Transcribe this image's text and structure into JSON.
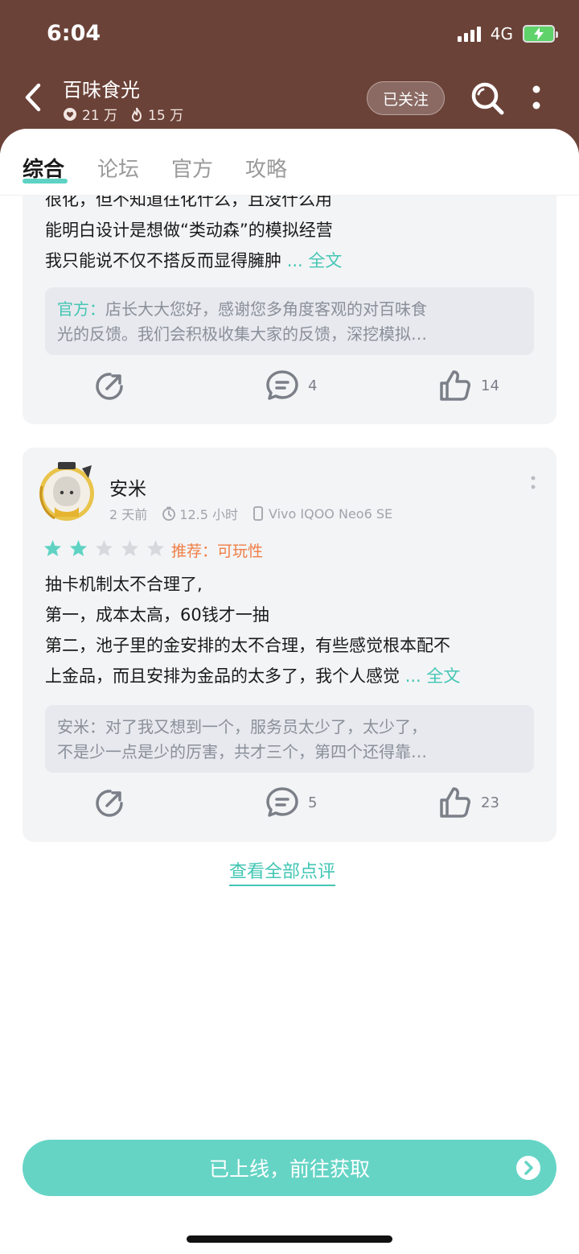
{
  "status_bar": {
    "time": "6:04",
    "network": "4G"
  },
  "header": {
    "title": "百味食光",
    "likes": "21 万",
    "hot": "15 万",
    "follow_label": "已关注"
  },
  "tabs": [
    {
      "label": "综合",
      "active": true
    },
    {
      "label": "论坛",
      "active": false
    },
    {
      "label": "官方",
      "active": false
    },
    {
      "label": "攻略",
      "active": false
    }
  ],
  "review1": {
    "lines": [
      "很化，但不知道往化什么，且没什么用",
      "能明白设计是想做“类动森”的模拟经营",
      "我只能说不仅不搭反而显得臃肿"
    ],
    "more_label": "... 全文",
    "reply_author": "官方：",
    "reply_lines": [
      "店长大大您好，感谢您多角度客观的对百味食",
      "光的反馈。我们会积极收集大家的反馈，深挖模拟…"
    ],
    "comments": "4",
    "likes": "14"
  },
  "review2": {
    "user_name": "安米",
    "time_ago": "2 天前",
    "playtime": "12.5 小时",
    "device": "Vivo IQOO Neo6 SE",
    "stars": 2,
    "recommend": "推荐：可玩性",
    "lines": [
      "抽卡机制太不合理了,",
      "第一，成本太高，60钱才一抽",
      "第二，池子里的金安排的太不合理，有些感觉根本配不",
      "上金品，而且安排为金品的太多了，我个人感觉"
    ],
    "more_label": "... 全文",
    "reply_author": "安米：",
    "reply_lines": [
      "对了我又想到一个，服务员太少了，太少了，",
      "不是少一点是少的厉害，共才三个，第四个还得靠…"
    ],
    "comments": "5",
    "likes": "23"
  },
  "view_all": "查看全部点评",
  "cta": "已上线，前往获取",
  "colors": {
    "header_bg": "#6b4238",
    "accent": "#43c6b4",
    "cta_bg": "#65d4c5",
    "card_bg": "#f3f4f6"
  }
}
